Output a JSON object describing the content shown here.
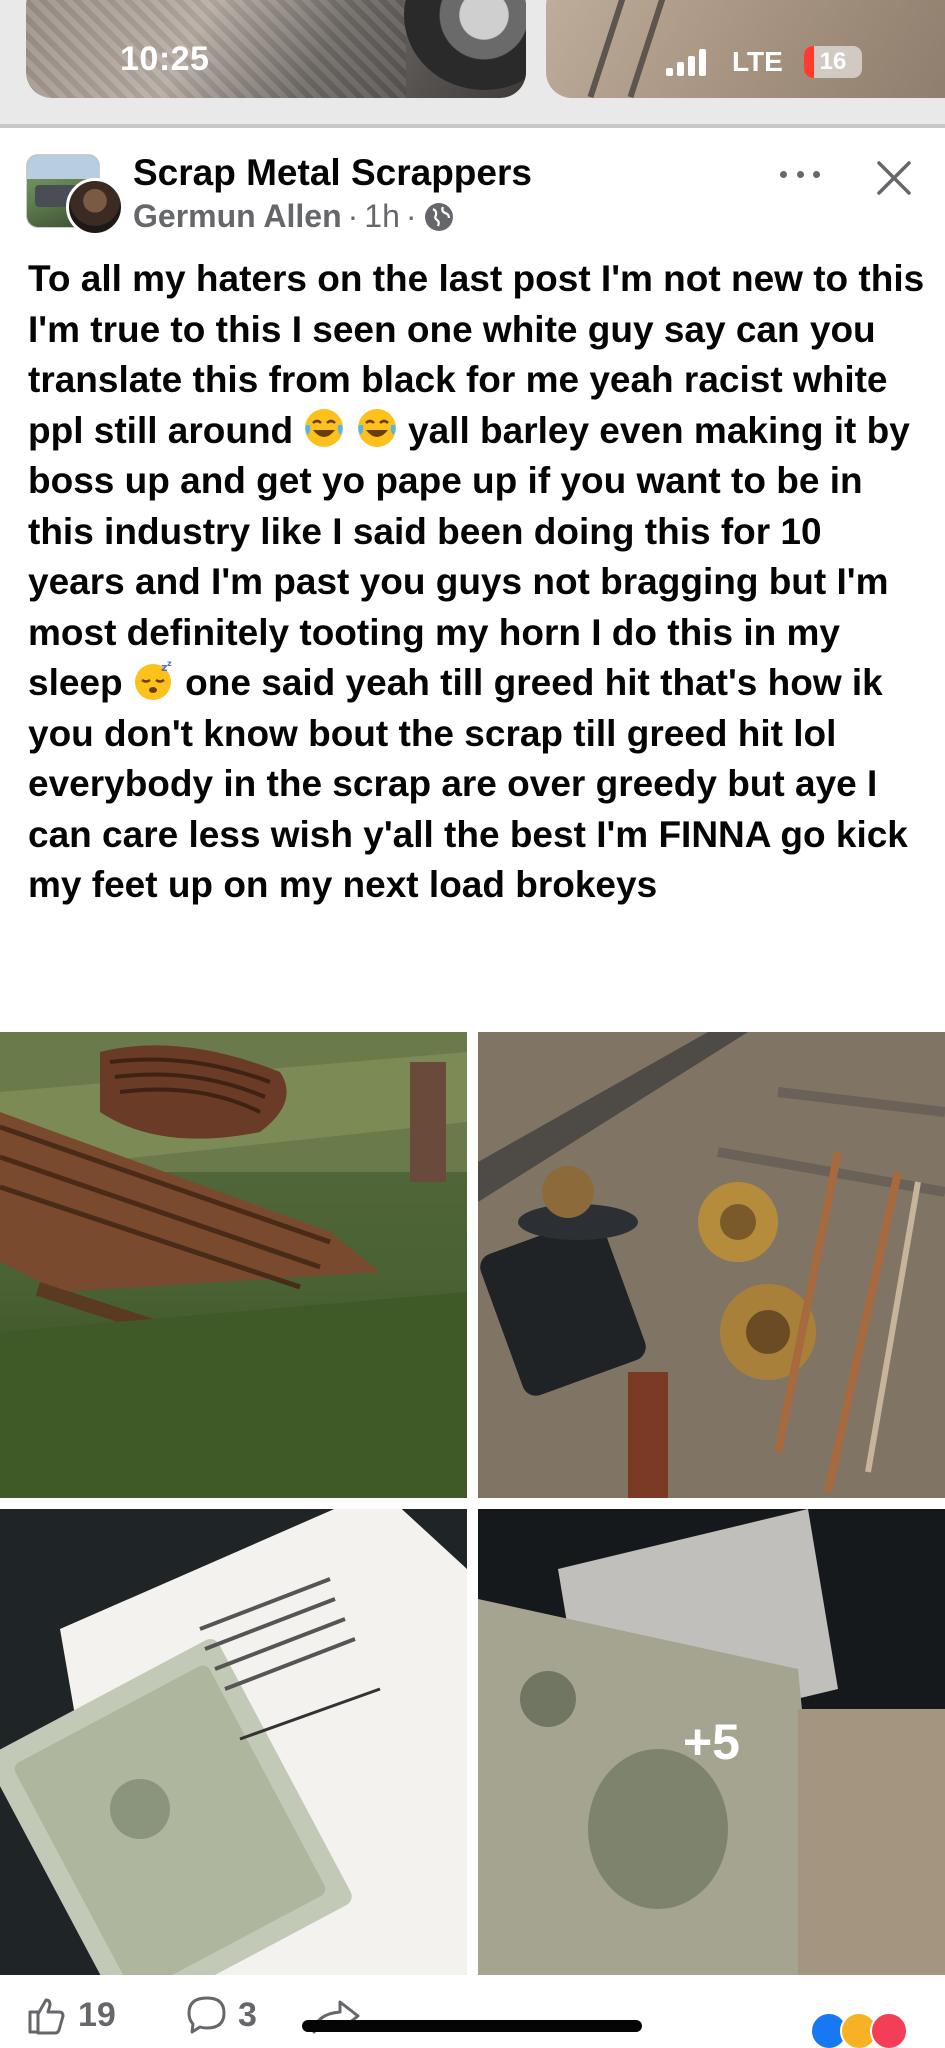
{
  "status_bar": {
    "time": "10:25",
    "network": "LTE",
    "battery": "16",
    "battery_color": "#ff3b30"
  },
  "post": {
    "group_name": "Scrap Metal Scrappers",
    "author": "Germun Allen",
    "separator": "·",
    "time": "1h",
    "privacy_icon": "globe-icon",
    "text_parts": {
      "p1": "To all my haters on the last post I'm not new to this I'm true to this I seen one white guy say can you translate this from black for me yeah racist white ppl still around ",
      "p2": " yall barley even making it by boss up and get yo pape up if you want to be in this industry like I said been doing this for 10 years and I'm past you guys not bragging but I'm most definitely tooting my horn I do this in my sleep ",
      "p3": " one said yeah till greed hit that's how ik you don't know bout the scrap till greed hit lol everybody in the scrap are over greedy but aye I can care less wish y'all the best I'm FINNA go kick my feet up on my next load brokeys"
    },
    "emojis": [
      "laughing-tears-emoji",
      "laughing-tears-emoji",
      "sleeping-emoji"
    ],
    "photos_more_label": "+5"
  },
  "reactions": {
    "like_count": "19",
    "comment_count": "3",
    "reaction_icons": [
      "like-reaction-icon",
      "haha-reaction-icon",
      "love-reaction-icon"
    ],
    "like_color": "#1877f2",
    "love_color": "#f33e58",
    "haha_color": "#f7b125"
  }
}
